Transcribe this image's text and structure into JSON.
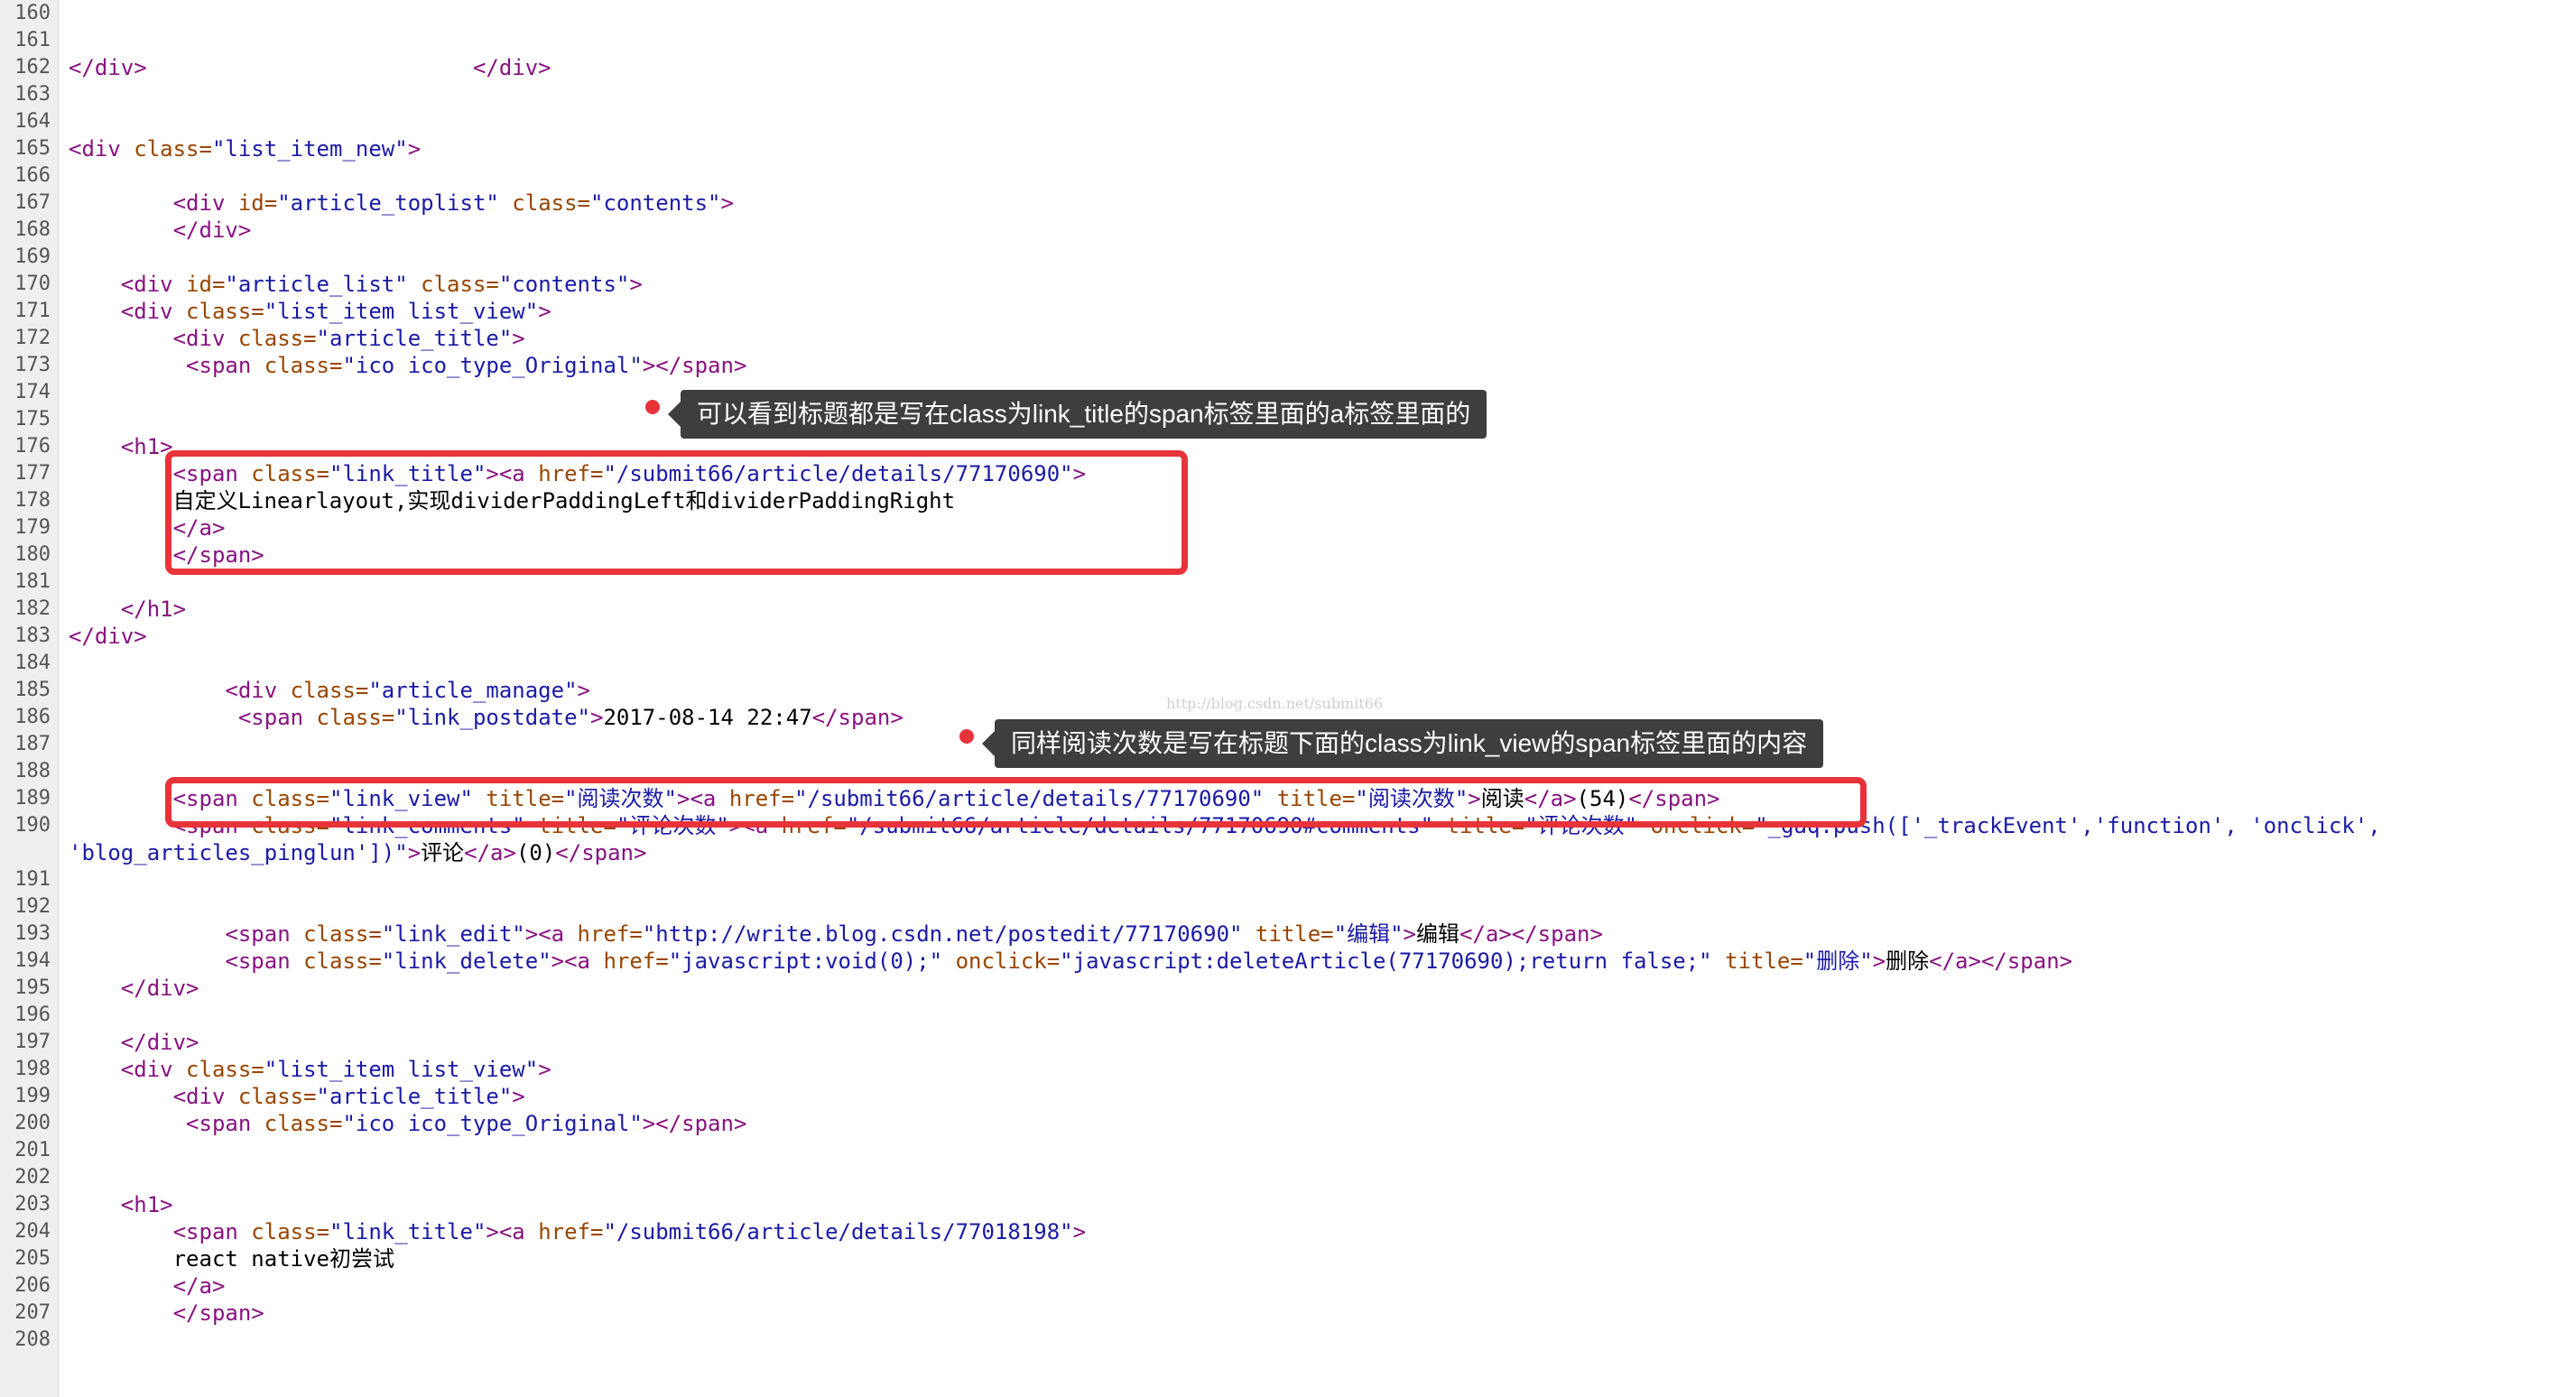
{
  "editor": {
    "lines": [
      {
        "no": "160",
        "tokens": []
      },
      {
        "no": "161",
        "tokens": []
      },
      {
        "no": "162",
        "tokens": [
          [
            "tag",
            "</div>"
          ],
          [
            "txt",
            "                         "
          ],
          [
            "tag",
            "</div>"
          ]
        ]
      },
      {
        "no": "163",
        "tokens": []
      },
      {
        "no": "164",
        "tokens": []
      },
      {
        "no": "165",
        "tokens": [
          [
            "tag",
            "<div "
          ],
          [
            "attr",
            "class="
          ],
          [
            "val",
            "\"list_item_new\""
          ],
          [
            "tag",
            ">"
          ]
        ]
      },
      {
        "no": "166",
        "tokens": []
      },
      {
        "no": "167",
        "tokens": [
          [
            "txt",
            "        "
          ],
          [
            "tag",
            "<div "
          ],
          [
            "attr",
            "id="
          ],
          [
            "val",
            "\"article_toplist\""
          ],
          [
            "txt",
            " "
          ],
          [
            "attr",
            "class="
          ],
          [
            "val",
            "\"contents\""
          ],
          [
            "tag",
            ">"
          ]
        ]
      },
      {
        "no": "168",
        "tokens": [
          [
            "txt",
            "        "
          ],
          [
            "tag",
            "</div>"
          ]
        ]
      },
      {
        "no": "169",
        "tokens": []
      },
      {
        "no": "170",
        "tokens": [
          [
            "txt",
            "    "
          ],
          [
            "tag",
            "<div "
          ],
          [
            "attr",
            "id="
          ],
          [
            "val",
            "\"article_list\""
          ],
          [
            "txt",
            " "
          ],
          [
            "attr",
            "class="
          ],
          [
            "val",
            "\"contents\""
          ],
          [
            "tag",
            ">"
          ]
        ]
      },
      {
        "no": "171",
        "tokens": [
          [
            "txt",
            "    "
          ],
          [
            "tag",
            "<div "
          ],
          [
            "attr",
            "class="
          ],
          [
            "val",
            "\"list_item list_view\""
          ],
          [
            "tag",
            ">"
          ]
        ]
      },
      {
        "no": "172",
        "tokens": [
          [
            "txt",
            "        "
          ],
          [
            "tag",
            "<div "
          ],
          [
            "attr",
            "class="
          ],
          [
            "val",
            "\"article_title\""
          ],
          [
            "tag",
            ">"
          ]
        ]
      },
      {
        "no": "173",
        "tokens": [
          [
            "txt",
            "         "
          ],
          [
            "tag",
            "<span "
          ],
          [
            "attr",
            "class="
          ],
          [
            "val",
            "\"ico ico_type_Original\""
          ],
          [
            "tag",
            "></span>"
          ]
        ]
      },
      {
        "no": "174",
        "tokens": []
      },
      {
        "no": "175",
        "tokens": []
      },
      {
        "no": "176",
        "tokens": [
          [
            "txt",
            "    "
          ],
          [
            "tag",
            "<h1>"
          ]
        ]
      },
      {
        "no": "177",
        "tokens": [
          [
            "txt",
            "        "
          ],
          [
            "tag",
            "<span "
          ],
          [
            "attr",
            "class="
          ],
          [
            "val",
            "\"link_title\""
          ],
          [
            "tag",
            "><a "
          ],
          [
            "attr",
            "href="
          ],
          [
            "val",
            "\"/submit66/article/details/77170690\""
          ],
          [
            "tag",
            ">"
          ]
        ]
      },
      {
        "no": "178",
        "tokens": [
          [
            "txt",
            "        自定义Linearlayout,实现dividerPaddingLeft和dividerPaddingRight"
          ]
        ]
      },
      {
        "no": "179",
        "tokens": [
          [
            "txt",
            "        "
          ],
          [
            "tag",
            "</a>"
          ]
        ]
      },
      {
        "no": "180",
        "tokens": [
          [
            "txt",
            "        "
          ],
          [
            "tag",
            "</span>"
          ]
        ]
      },
      {
        "no": "181",
        "tokens": []
      },
      {
        "no": "182",
        "tokens": [
          [
            "txt",
            "    "
          ],
          [
            "tag",
            "</h1>"
          ]
        ]
      },
      {
        "no": "183",
        "tokens": [
          [
            "tag",
            "</div>"
          ]
        ]
      },
      {
        "no": "184",
        "tokens": []
      },
      {
        "no": "185",
        "tokens": [
          [
            "txt",
            "            "
          ],
          [
            "tag",
            "<div "
          ],
          [
            "attr",
            "class="
          ],
          [
            "val",
            "\"article_manage\""
          ],
          [
            "tag",
            ">"
          ]
        ]
      },
      {
        "no": "186",
        "tokens": [
          [
            "txt",
            "             "
          ],
          [
            "tag",
            "<span "
          ],
          [
            "attr",
            "class="
          ],
          [
            "val",
            "\"link_postdate\""
          ],
          [
            "tag",
            ">"
          ],
          [
            "txt",
            "2017-08-14 22:47"
          ],
          [
            "tag",
            "</span>"
          ]
        ]
      },
      {
        "no": "187",
        "tokens": []
      },
      {
        "no": "188",
        "tokens": []
      },
      {
        "no": "189",
        "tokens": [
          [
            "txt",
            "        "
          ],
          [
            "tag",
            "<span "
          ],
          [
            "attr",
            "class="
          ],
          [
            "val",
            "\"link_view\""
          ],
          [
            "txt",
            " "
          ],
          [
            "attr",
            "title="
          ],
          [
            "val",
            "\"阅读次数\""
          ],
          [
            "tag",
            "><a "
          ],
          [
            "attr",
            "href="
          ],
          [
            "val",
            "\"/submit66/article/details/77170690\""
          ],
          [
            "txt",
            " "
          ],
          [
            "attr",
            "title="
          ],
          [
            "val",
            "\"阅读次数\""
          ],
          [
            "tag",
            ">"
          ],
          [
            "txt",
            "阅读"
          ],
          [
            "tag",
            "</a>"
          ],
          [
            "txt",
            "(54)"
          ],
          [
            "tag",
            "</span>"
          ]
        ]
      },
      {
        "no": "190",
        "tokens": [
          [
            "txt",
            "        "
          ],
          [
            "tag",
            "<span "
          ],
          [
            "attr",
            "class="
          ],
          [
            "val",
            "\"link_comments\""
          ],
          [
            "txt",
            " "
          ],
          [
            "attr",
            "title="
          ],
          [
            "val",
            "\"评论次数\""
          ],
          [
            "tag",
            "><a "
          ],
          [
            "attr",
            "href="
          ],
          [
            "val",
            "\"/submit66/article/details/77170690#comments\""
          ],
          [
            "txt",
            " "
          ],
          [
            "attr",
            "title="
          ],
          [
            "val",
            "\"评论次数\""
          ],
          [
            "txt",
            " "
          ],
          [
            "attr",
            "onclick="
          ],
          [
            "val",
            "\"_gaq.push(['_trackEvent','function', 'onclick',"
          ]
        ]
      },
      {
        "no": "",
        "tokens": [
          [
            "val",
            "'blog_articles_pinglun'])\""
          ],
          [
            "tag",
            ">"
          ],
          [
            "txt",
            "评论"
          ],
          [
            "tag",
            "</a>"
          ],
          [
            "txt",
            "(0)"
          ],
          [
            "tag",
            "</span>"
          ]
        ]
      },
      {
        "no": "191",
        "tokens": []
      },
      {
        "no": "192",
        "tokens": []
      },
      {
        "no": "193",
        "tokens": [
          [
            "txt",
            "            "
          ],
          [
            "tag",
            "<span "
          ],
          [
            "attr",
            "class="
          ],
          [
            "val",
            "\"link_edit\""
          ],
          [
            "tag",
            "><a "
          ],
          [
            "attr",
            "href="
          ],
          [
            "val",
            "\"http://write.blog.csdn.net/postedit/77170690\""
          ],
          [
            "txt",
            " "
          ],
          [
            "attr",
            "title="
          ],
          [
            "val",
            "\"编辑\""
          ],
          [
            "tag",
            ">"
          ],
          [
            "txt",
            "编辑"
          ],
          [
            "tag",
            "</a></span>"
          ]
        ]
      },
      {
        "no": "194",
        "tokens": [
          [
            "txt",
            "            "
          ],
          [
            "tag",
            "<span "
          ],
          [
            "attr",
            "class="
          ],
          [
            "val",
            "\"link_delete\""
          ],
          [
            "tag",
            "><a "
          ],
          [
            "attr",
            "href="
          ],
          [
            "val",
            "\"javascript:void(0);\""
          ],
          [
            "txt",
            " "
          ],
          [
            "attr",
            "onclick="
          ],
          [
            "val",
            "\"javascript:deleteArticle(77170690);return false;\""
          ],
          [
            "txt",
            " "
          ],
          [
            "attr",
            "title="
          ],
          [
            "val",
            "\"删除\""
          ],
          [
            "tag",
            ">"
          ],
          [
            "txt",
            "删除"
          ],
          [
            "tag",
            "</a></span>"
          ]
        ]
      },
      {
        "no": "195",
        "tokens": [
          [
            "txt",
            "    "
          ],
          [
            "tag",
            "</div>"
          ]
        ]
      },
      {
        "no": "196",
        "tokens": []
      },
      {
        "no": "197",
        "tokens": [
          [
            "txt",
            "    "
          ],
          [
            "tag",
            "</div>"
          ]
        ]
      },
      {
        "no": "198",
        "tokens": [
          [
            "txt",
            "    "
          ],
          [
            "tag",
            "<div "
          ],
          [
            "attr",
            "class="
          ],
          [
            "val",
            "\"list_item list_view\""
          ],
          [
            "tag",
            ">"
          ]
        ]
      },
      {
        "no": "199",
        "tokens": [
          [
            "txt",
            "        "
          ],
          [
            "tag",
            "<div "
          ],
          [
            "attr",
            "class="
          ],
          [
            "val",
            "\"article_title\""
          ],
          [
            "tag",
            ">"
          ]
        ]
      },
      {
        "no": "200",
        "tokens": [
          [
            "txt",
            "         "
          ],
          [
            "tag",
            "<span "
          ],
          [
            "attr",
            "class="
          ],
          [
            "val",
            "\"ico ico_type_Original\""
          ],
          [
            "tag",
            "></span>"
          ]
        ]
      },
      {
        "no": "201",
        "tokens": []
      },
      {
        "no": "202",
        "tokens": []
      },
      {
        "no": "203",
        "tokens": [
          [
            "txt",
            "    "
          ],
          [
            "tag",
            "<h1>"
          ]
        ]
      },
      {
        "no": "204",
        "tokens": [
          [
            "txt",
            "        "
          ],
          [
            "tag",
            "<span "
          ],
          [
            "attr",
            "class="
          ],
          [
            "val",
            "\"link_title\""
          ],
          [
            "tag",
            "><a "
          ],
          [
            "attr",
            "href="
          ],
          [
            "val",
            "\"/submit66/article/details/77018198\""
          ],
          [
            "tag",
            ">"
          ]
        ]
      },
      {
        "no": "205",
        "tokens": [
          [
            "txt",
            "        react native初尝试"
          ]
        ]
      },
      {
        "no": "206",
        "tokens": [
          [
            "txt",
            "        "
          ],
          [
            "tag",
            "</a>"
          ]
        ]
      },
      {
        "no": "207",
        "tokens": [
          [
            "txt",
            "        "
          ],
          [
            "tag",
            "</span>"
          ]
        ]
      },
      {
        "no": "208",
        "tokens": []
      }
    ]
  },
  "annotations": {
    "title_note": "可以看到标题都是写在class为link_title的span标签里面的a标签里面的",
    "view_note": "同样阅读次数是写在标题下面的class为link_view的span标签里面的内容"
  },
  "watermark": "http://blog.csdn.net/submit66",
  "colors": {
    "highlight": "#e8333a",
    "tag": "#881280",
    "attr": "#994500",
    "value": "#1a1aa6",
    "tooltip_bg": "#3e3e3e"
  }
}
